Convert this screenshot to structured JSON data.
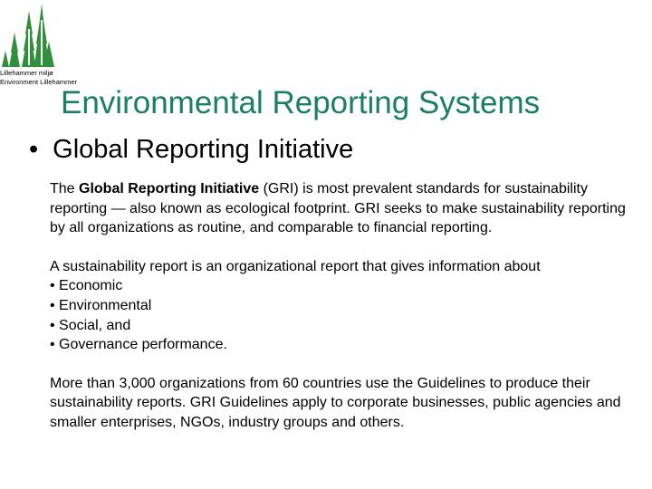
{
  "logo": {
    "icon": "tree-icon",
    "color": "#2f8f3a",
    "line1": "Lillehammer miljø",
    "line2": "Environment Lillehammer"
  },
  "slide": {
    "title": "Environmental Reporting Systems",
    "title_color": "#1b7f66",
    "bullet": "•",
    "heading": "Global Reporting Initiative",
    "para1": {
      "prefix": "The ",
      "bold": "Global Reporting Initiative",
      "suffix": " (GRI) is most prevalent standards for sustainability reporting — also known as ecological  footprint. GRI seeks to make sustainability reporting by all organizations as routine, and comparable to financial reporting."
    },
    "para2_intro": "A sustainability report is an organizational report that gives information about",
    "list": [
      "• Economic",
      "• Environmental",
      "• Social, and",
      "• Governance performance."
    ],
    "para3": "More than 3,000 organizations from 60 countries use the Guidelines to produce their sustainability reports. GRI Guidelines apply to corporate businesses, public agencies and smaller enterprises, NGOs, industry groups and others."
  }
}
